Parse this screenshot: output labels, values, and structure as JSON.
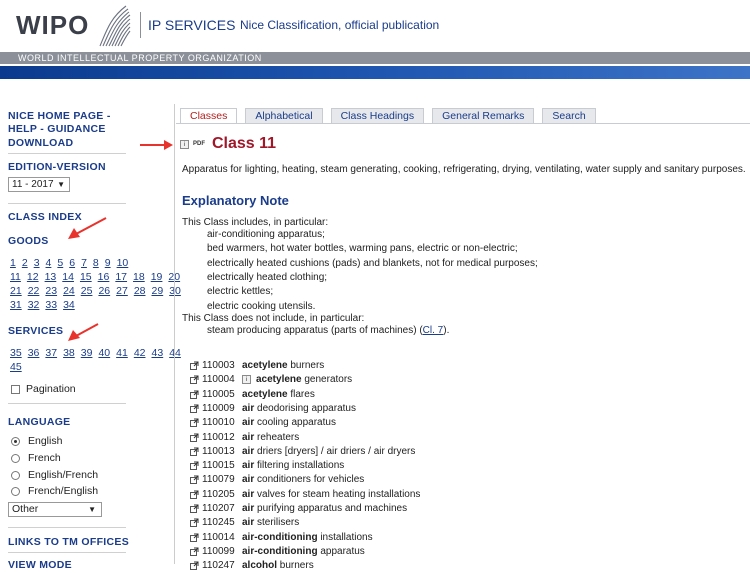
{
  "header": {
    "logo": "WIPO",
    "service": "IP SERVICES",
    "title": "Nice Classification, official publication",
    "org": "WORLD INTELLECTUAL PROPERTY ORGANIZATION"
  },
  "sidebar": {
    "links": [
      "NICE HOME PAGE -",
      "HELP - GUIDANCE",
      "DOWNLOAD"
    ],
    "edition_label": "EDITION-VERSION",
    "edition_value": "11 - 2017",
    "class_index": "CLASS INDEX",
    "goods": "GOODS",
    "goods_rows": [
      [
        "1",
        "2",
        "3",
        "4",
        "5",
        "6",
        "7",
        "8",
        "9",
        "10"
      ],
      [
        "11",
        "12",
        "13",
        "14",
        "15",
        "16",
        "17",
        "18",
        "19",
        "20"
      ],
      [
        "21",
        "22",
        "23",
        "24",
        "25",
        "26",
        "27",
        "28",
        "29",
        "30"
      ],
      [
        "31",
        "32",
        "33",
        "34"
      ]
    ],
    "services": "SERVICES",
    "services_rows": [
      [
        "35",
        "36",
        "37",
        "38",
        "39",
        "40",
        "41",
        "42",
        "43",
        "44"
      ],
      [
        "45"
      ]
    ],
    "pagination": "Pagination",
    "language_label": "LANGUAGE",
    "languages": [
      "English",
      "French",
      "English/French",
      "French/English"
    ],
    "language_selected": "English",
    "other_select": "Other",
    "links_tm": "LINKS TO TM OFFICES",
    "view_mode": "VIEW MODE"
  },
  "tabs": [
    "Classes",
    "Alphabetical",
    "Class Headings",
    "General Remarks",
    "Search"
  ],
  "active_tab": "Classes",
  "main": {
    "class_title": "Class 11",
    "pdf_label": "PDF",
    "heading": "Apparatus for lighting, heating, steam generating, cooking, refrigerating, drying, ventilating, water supply and sanitary purposes.",
    "expl_title": "Explanatory Note",
    "includes_intro": "This Class includes, in particular:",
    "includes": [
      "air-conditioning apparatus;",
      "bed warmers, hot water bottles, warming pans, electric or non-electric;",
      "electrically heated cushions (pads) and blankets, not for medical purposes;",
      "electrically heated clothing;",
      "electric kettles;",
      "electric cooking utensils."
    ],
    "excludes_intro": "This Class does not include, in particular:",
    "excludes_text": "steam producing apparatus (parts of machines) (",
    "excludes_link": "Cl. 7",
    "excludes_end": ").",
    "entries": [
      {
        "num": "110003",
        "bold": "acetylene",
        "rest": " burners"
      },
      {
        "num": "110004",
        "bold": "acetylene",
        "rest": " generators",
        "icon": true
      },
      {
        "num": "110005",
        "bold": "acetylene",
        "rest": " flares"
      },
      {
        "num": "110009",
        "bold": "air",
        "rest": " deodorising apparatus"
      },
      {
        "num": "110010",
        "bold": "air",
        "rest": " cooling apparatus"
      },
      {
        "num": "110012",
        "bold": "air",
        "rest": " reheaters"
      },
      {
        "num": "110013",
        "bold": "air",
        "rest": " driers [dryers] / air driers / air dryers"
      },
      {
        "num": "110015",
        "bold": "air",
        "rest": " filtering installations"
      },
      {
        "num": "110079",
        "bold": "air",
        "rest": " conditioners for vehicles"
      },
      {
        "num": "110205",
        "bold": "air",
        "rest": " valves for steam heating installations"
      },
      {
        "num": "110207",
        "bold": "air",
        "rest": " purifying apparatus and machines"
      },
      {
        "num": "110245",
        "bold": "air",
        "rest": " sterilisers"
      },
      {
        "num": "110014",
        "bold": "air-conditioning",
        "rest": " installations"
      },
      {
        "num": "110099",
        "bold": "air-conditioning",
        "rest": " apparatus"
      },
      {
        "num": "110247",
        "bold": "alcohol",
        "rest": " burners"
      }
    ]
  },
  "colors": {
    "brand_blue": "#1a3c8a",
    "class_red": "#a1172a",
    "arrow_red": "#e8322c"
  }
}
